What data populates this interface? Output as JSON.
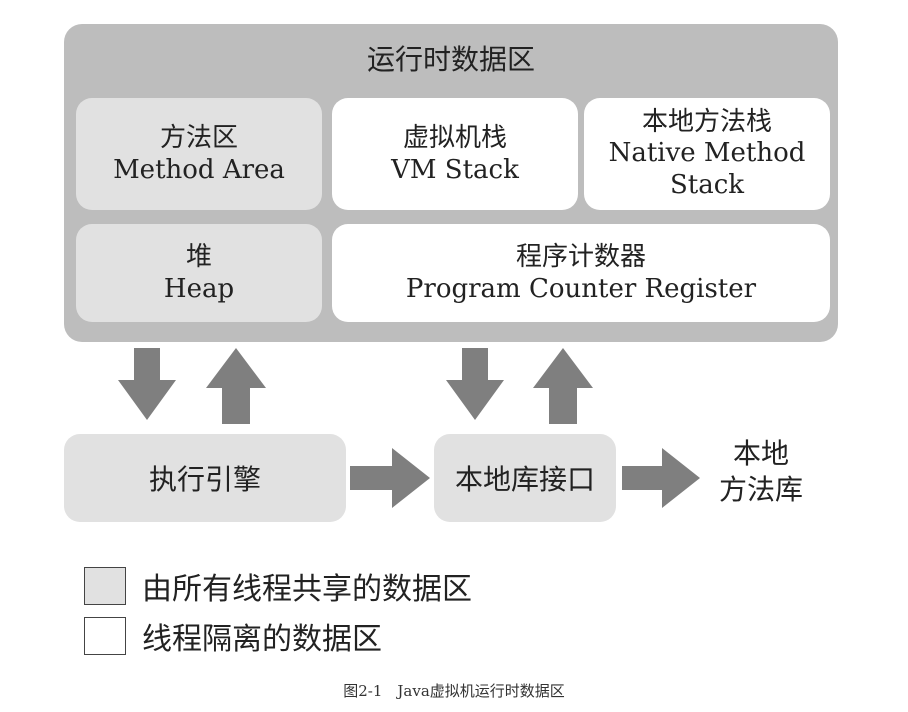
{
  "runtime_area": {
    "title": "运行时数据区"
  },
  "method_area": {
    "zh": "方法区",
    "en": "Method Area"
  },
  "vm_stack": {
    "zh": "虚拟机栈",
    "en": "VM Stack"
  },
  "native_method_stack": {
    "zh": "本地方法栈",
    "en_line1": "Native Method",
    "en_line2": "Stack"
  },
  "heap": {
    "zh": "堆",
    "en": "Heap"
  },
  "pc_register": {
    "zh": "程序计数器",
    "en": "Program Counter Register"
  },
  "execution_engine": "执行引擎",
  "native_interface": "本地库接口",
  "native_library": {
    "line1": "本地",
    "line2": "方法库"
  },
  "legend": {
    "shared": "由所有线程共享的数据区",
    "isolated": "线程隔离的数据区"
  },
  "caption": "图2-1　Java虚拟机运行时数据区",
  "colors": {
    "runtime_bg": "#bdbdbd",
    "shared_bg": "#e1e1e1",
    "private_bg": "#ffffff",
    "arrow": "#7f7f7f"
  }
}
